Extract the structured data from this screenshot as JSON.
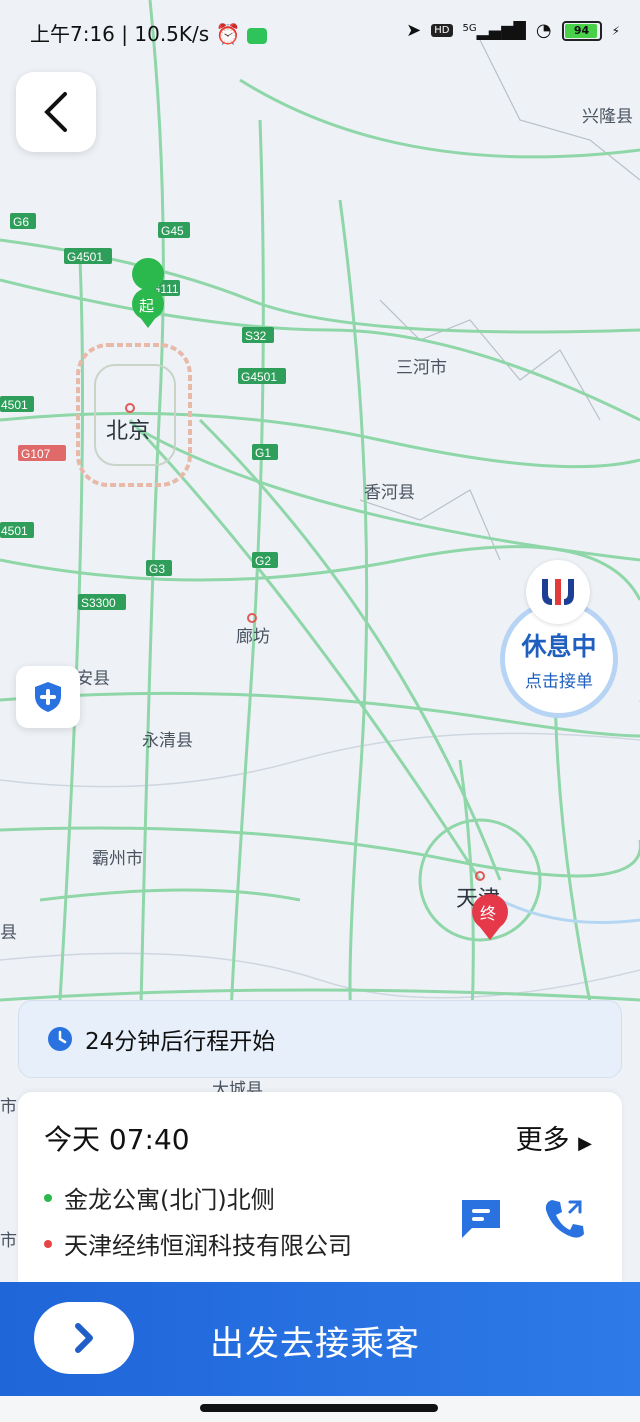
{
  "status_bar": {
    "time": "上午7:16 | 10.5K/s",
    "net": "5G",
    "hd": "HD",
    "battery": "94"
  },
  "map": {
    "cities": [
      "兴隆县",
      "三河市",
      "北京",
      "香河县",
      "廊坊",
      "安县",
      "永清县",
      "霸州市",
      "天津",
      "县",
      "大城县",
      "市",
      "市"
    ],
    "roads": [
      "G6",
      "G45",
      "G4501",
      "G111",
      "S32",
      "G4501",
      "4501",
      "G1",
      "G107",
      "4501",
      "G2",
      "G3",
      "S3300"
    ],
    "start_marker": "起",
    "end_marker": "终"
  },
  "rest_button": {
    "title": "休息中",
    "subtitle": "点击接单"
  },
  "notice": {
    "text": "24分钟后行程开始"
  },
  "trip_card": {
    "time": "今天 07:40",
    "more": "更多",
    "pickup": "金龙公寓(北门)北侧",
    "dropoff": "天津经纬恒润科技有限公司"
  },
  "action": {
    "label": "出发去接乘客"
  },
  "colors": {
    "accent": "#2e7ae8",
    "pickup_dot": "#2bb84d",
    "dropoff_dot": "#e54545",
    "road": "#7cd19a"
  }
}
